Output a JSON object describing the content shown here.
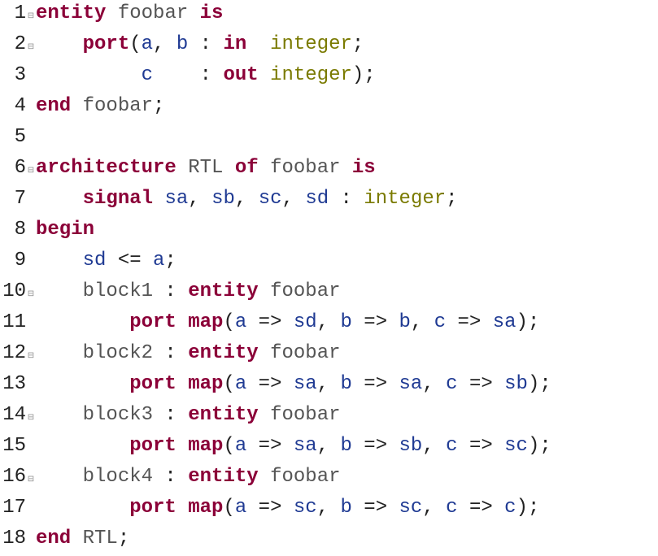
{
  "code": {
    "lines": [
      {
        "n": "1",
        "fold": "⊟",
        "tokens": [
          {
            "c": "kw",
            "t": "entity"
          },
          {
            "c": "op",
            "t": " "
          },
          {
            "c": "lbl",
            "t": "foobar"
          },
          {
            "c": "op",
            "t": " "
          },
          {
            "c": "kw",
            "t": "is"
          }
        ]
      },
      {
        "n": "2",
        "fold": "⊟",
        "tokens": [
          {
            "c": "op",
            "t": "    "
          },
          {
            "c": "kw",
            "t": "port"
          },
          {
            "c": "op",
            "t": "("
          },
          {
            "c": "id",
            "t": "a"
          },
          {
            "c": "op",
            "t": ", "
          },
          {
            "c": "id",
            "t": "b"
          },
          {
            "c": "op",
            "t": " : "
          },
          {
            "c": "kw",
            "t": "in"
          },
          {
            "c": "op",
            "t": "  "
          },
          {
            "c": "ty",
            "t": "integer"
          },
          {
            "c": "op",
            "t": ";"
          }
        ]
      },
      {
        "n": "3",
        "fold": " ",
        "tokens": [
          {
            "c": "op",
            "t": "         "
          },
          {
            "c": "id",
            "t": "c"
          },
          {
            "c": "op",
            "t": "    : "
          },
          {
            "c": "kw",
            "t": "out"
          },
          {
            "c": "op",
            "t": " "
          },
          {
            "c": "ty",
            "t": "integer"
          },
          {
            "c": "op",
            "t": ");"
          }
        ]
      },
      {
        "n": "4",
        "fold": " ",
        "tokens": [
          {
            "c": "kw",
            "t": "end"
          },
          {
            "c": "op",
            "t": " "
          },
          {
            "c": "lbl",
            "t": "foobar"
          },
          {
            "c": "op",
            "t": ";"
          }
        ]
      },
      {
        "n": "5",
        "fold": " ",
        "tokens": [
          {
            "c": "op",
            "t": ""
          }
        ]
      },
      {
        "n": "6",
        "fold": "⊟",
        "tokens": [
          {
            "c": "kw",
            "t": "architecture"
          },
          {
            "c": "op",
            "t": " "
          },
          {
            "c": "lbl",
            "t": "RTL"
          },
          {
            "c": "op",
            "t": " "
          },
          {
            "c": "kw",
            "t": "of"
          },
          {
            "c": "op",
            "t": " "
          },
          {
            "c": "lbl",
            "t": "foobar"
          },
          {
            "c": "op",
            "t": " "
          },
          {
            "c": "kw",
            "t": "is"
          }
        ]
      },
      {
        "n": "7",
        "fold": " ",
        "tokens": [
          {
            "c": "op",
            "t": "    "
          },
          {
            "c": "kw",
            "t": "signal"
          },
          {
            "c": "op",
            "t": " "
          },
          {
            "c": "id",
            "t": "sa"
          },
          {
            "c": "op",
            "t": ", "
          },
          {
            "c": "id",
            "t": "sb"
          },
          {
            "c": "op",
            "t": ", "
          },
          {
            "c": "id",
            "t": "sc"
          },
          {
            "c": "op",
            "t": ", "
          },
          {
            "c": "id",
            "t": "sd"
          },
          {
            "c": "op",
            "t": " : "
          },
          {
            "c": "ty",
            "t": "integer"
          },
          {
            "c": "op",
            "t": ";"
          }
        ]
      },
      {
        "n": "8",
        "fold": " ",
        "tokens": [
          {
            "c": "kw",
            "t": "begin"
          }
        ]
      },
      {
        "n": "9",
        "fold": " ",
        "tokens": [
          {
            "c": "op",
            "t": "    "
          },
          {
            "c": "id",
            "t": "sd"
          },
          {
            "c": "op",
            "t": " <= "
          },
          {
            "c": "id",
            "t": "a"
          },
          {
            "c": "op",
            "t": ";"
          }
        ]
      },
      {
        "n": "10",
        "fold": "⊟",
        "tokens": [
          {
            "c": "op",
            "t": "    "
          },
          {
            "c": "lbl",
            "t": "block1"
          },
          {
            "c": "op",
            "t": " : "
          },
          {
            "c": "kw",
            "t": "entity"
          },
          {
            "c": "op",
            "t": " "
          },
          {
            "c": "lbl",
            "t": "foobar"
          }
        ]
      },
      {
        "n": "11",
        "fold": " ",
        "tokens": [
          {
            "c": "op",
            "t": "        "
          },
          {
            "c": "kw",
            "t": "port"
          },
          {
            "c": "op",
            "t": " "
          },
          {
            "c": "kw",
            "t": "map"
          },
          {
            "c": "op",
            "t": "("
          },
          {
            "c": "id",
            "t": "a"
          },
          {
            "c": "op",
            "t": " => "
          },
          {
            "c": "id",
            "t": "sd"
          },
          {
            "c": "op",
            "t": ", "
          },
          {
            "c": "id",
            "t": "b"
          },
          {
            "c": "op",
            "t": " => "
          },
          {
            "c": "id",
            "t": "b"
          },
          {
            "c": "op",
            "t": ", "
          },
          {
            "c": "id",
            "t": "c"
          },
          {
            "c": "op",
            "t": " => "
          },
          {
            "c": "id",
            "t": "sa"
          },
          {
            "c": "op",
            "t": ");"
          }
        ]
      },
      {
        "n": "12",
        "fold": "⊟",
        "tokens": [
          {
            "c": "op",
            "t": "    "
          },
          {
            "c": "lbl",
            "t": "block2"
          },
          {
            "c": "op",
            "t": " : "
          },
          {
            "c": "kw",
            "t": "entity"
          },
          {
            "c": "op",
            "t": " "
          },
          {
            "c": "lbl",
            "t": "foobar"
          }
        ]
      },
      {
        "n": "13",
        "fold": " ",
        "tokens": [
          {
            "c": "op",
            "t": "        "
          },
          {
            "c": "kw",
            "t": "port"
          },
          {
            "c": "op",
            "t": " "
          },
          {
            "c": "kw",
            "t": "map"
          },
          {
            "c": "op",
            "t": "("
          },
          {
            "c": "id",
            "t": "a"
          },
          {
            "c": "op",
            "t": " => "
          },
          {
            "c": "id",
            "t": "sa"
          },
          {
            "c": "op",
            "t": ", "
          },
          {
            "c": "id",
            "t": "b"
          },
          {
            "c": "op",
            "t": " => "
          },
          {
            "c": "id",
            "t": "sa"
          },
          {
            "c": "op",
            "t": ", "
          },
          {
            "c": "id",
            "t": "c"
          },
          {
            "c": "op",
            "t": " => "
          },
          {
            "c": "id",
            "t": "sb"
          },
          {
            "c": "op",
            "t": ");"
          }
        ]
      },
      {
        "n": "14",
        "fold": "⊟",
        "tokens": [
          {
            "c": "op",
            "t": "    "
          },
          {
            "c": "lbl",
            "t": "block3"
          },
          {
            "c": "op",
            "t": " : "
          },
          {
            "c": "kw",
            "t": "entity"
          },
          {
            "c": "op",
            "t": " "
          },
          {
            "c": "lbl",
            "t": "foobar"
          }
        ]
      },
      {
        "n": "15",
        "fold": " ",
        "tokens": [
          {
            "c": "op",
            "t": "        "
          },
          {
            "c": "kw",
            "t": "port"
          },
          {
            "c": "op",
            "t": " "
          },
          {
            "c": "kw",
            "t": "map"
          },
          {
            "c": "op",
            "t": "("
          },
          {
            "c": "id",
            "t": "a"
          },
          {
            "c": "op",
            "t": " => "
          },
          {
            "c": "id",
            "t": "sa"
          },
          {
            "c": "op",
            "t": ", "
          },
          {
            "c": "id",
            "t": "b"
          },
          {
            "c": "op",
            "t": " => "
          },
          {
            "c": "id",
            "t": "sb"
          },
          {
            "c": "op",
            "t": ", "
          },
          {
            "c": "id",
            "t": "c"
          },
          {
            "c": "op",
            "t": " => "
          },
          {
            "c": "id",
            "t": "sc"
          },
          {
            "c": "op",
            "t": ");"
          }
        ]
      },
      {
        "n": "16",
        "fold": "⊟",
        "tokens": [
          {
            "c": "op",
            "t": "    "
          },
          {
            "c": "lbl",
            "t": "block4"
          },
          {
            "c": "op",
            "t": " : "
          },
          {
            "c": "kw",
            "t": "entity"
          },
          {
            "c": "op",
            "t": " "
          },
          {
            "c": "lbl",
            "t": "foobar"
          }
        ]
      },
      {
        "n": "17",
        "fold": " ",
        "tokens": [
          {
            "c": "op",
            "t": "        "
          },
          {
            "c": "kw",
            "t": "port"
          },
          {
            "c": "op",
            "t": " "
          },
          {
            "c": "kw",
            "t": "map"
          },
          {
            "c": "op",
            "t": "("
          },
          {
            "c": "id",
            "t": "a"
          },
          {
            "c": "op",
            "t": " => "
          },
          {
            "c": "id",
            "t": "sc"
          },
          {
            "c": "op",
            "t": ", "
          },
          {
            "c": "id",
            "t": "b"
          },
          {
            "c": "op",
            "t": " => "
          },
          {
            "c": "id",
            "t": "sc"
          },
          {
            "c": "op",
            "t": ", "
          },
          {
            "c": "id",
            "t": "c"
          },
          {
            "c": "op",
            "t": " => "
          },
          {
            "c": "id",
            "t": "c"
          },
          {
            "c": "op",
            "t": ");"
          }
        ]
      },
      {
        "n": "18",
        "fold": " ",
        "tokens": [
          {
            "c": "kw",
            "t": "end"
          },
          {
            "c": "op",
            "t": " "
          },
          {
            "c": "lbl",
            "t": "RTL"
          },
          {
            "c": "op",
            "t": ";"
          }
        ]
      }
    ]
  }
}
